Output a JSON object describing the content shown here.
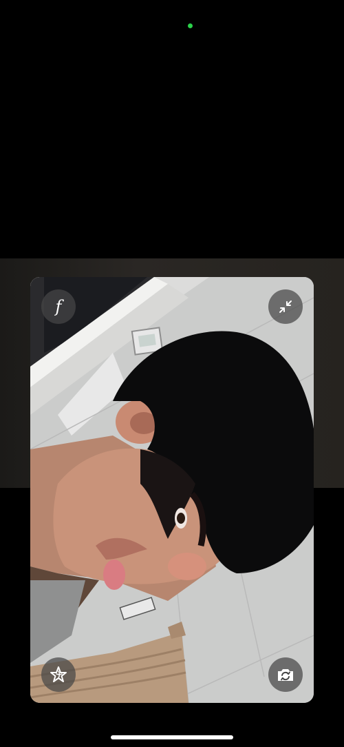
{
  "status": {
    "indicator_color": "#2bd14a"
  },
  "camera": {
    "filter_button": {
      "icon": "f-icon",
      "label": "f"
    },
    "collapse_button": {
      "icon": "collapse-arrows-icon"
    },
    "effects_button": {
      "icon": "star-effects-icon"
    },
    "flip_button": {
      "icon": "camera-flip-icon"
    }
  },
  "system": {
    "home_indicator": true
  }
}
